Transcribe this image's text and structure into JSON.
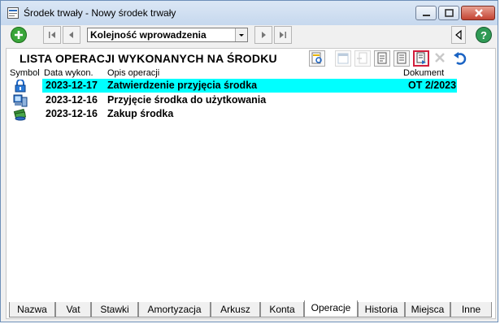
{
  "window": {
    "title": "Środek trwały - Nowy środek trwały"
  },
  "toolbar": {
    "sort_value": "Kolejność wprowadzenia"
  },
  "list": {
    "title": "LISTA OPERACJI WYKONANYCH NA ŚRODKU",
    "columns": {
      "symbol": "Symbol",
      "date": "Data wykon.",
      "description": "Opis operacji",
      "document": "Dokument"
    },
    "rows": [
      {
        "date": "2023-12-17",
        "description": "Zatwierdzenie przyjęcia środka",
        "document": "OT 2/2023",
        "icon": "lock-icon",
        "selected": true
      },
      {
        "date": "2023-12-16",
        "description": "Przyjęcie środka do użytkowania",
        "document": "",
        "icon": "computer-icon",
        "selected": false
      },
      {
        "date": "2023-12-16",
        "description": "Zakup środka",
        "document": "",
        "icon": "money-icon",
        "selected": false
      }
    ]
  },
  "tabs": [
    "Nazwa",
    "Vat",
    "Stawki",
    "Amortyzacja",
    "Arkusz",
    "Konta",
    "Operacje",
    "Historia",
    "Miejsca",
    "Inne"
  ],
  "active_tab": "Operacje",
  "colors": {
    "selection": "#00ffff",
    "add_button": "#3aa63a",
    "help_button": "#2f9a55",
    "highlight_border": "#d21f3c"
  }
}
